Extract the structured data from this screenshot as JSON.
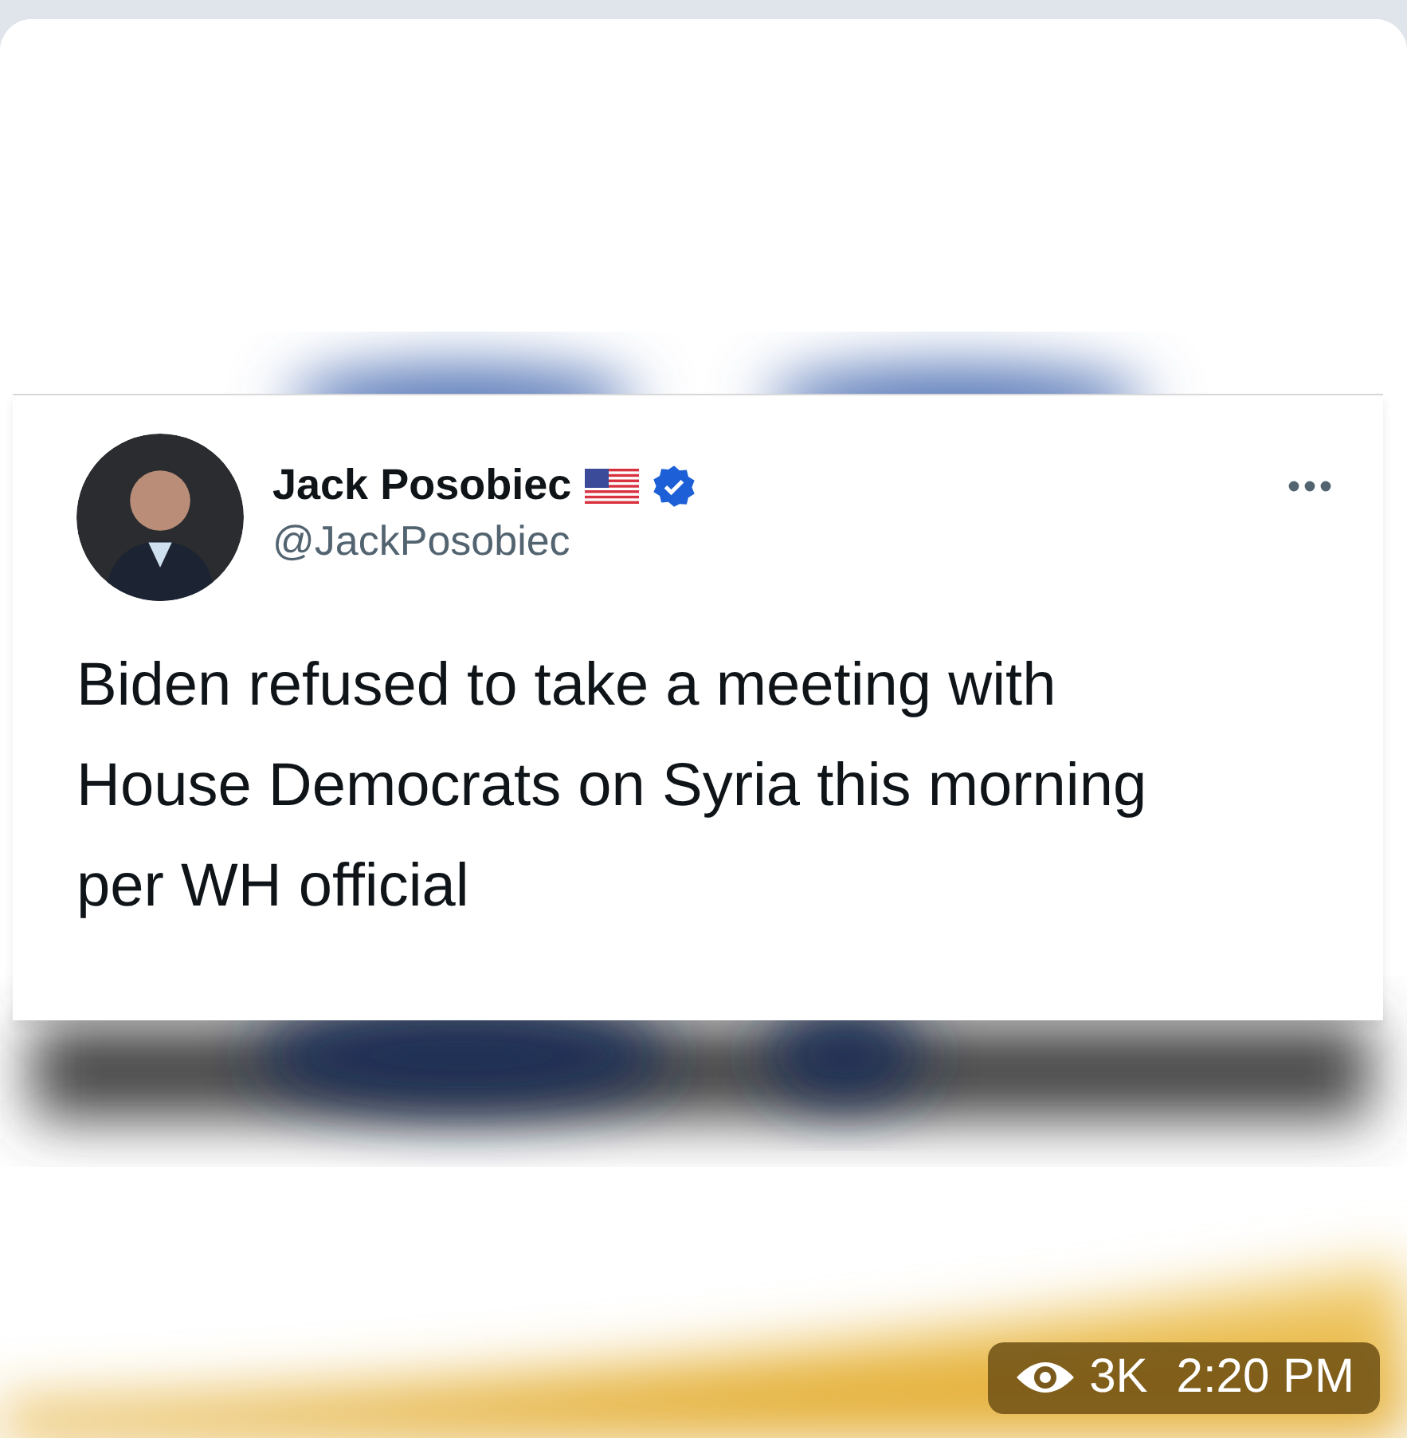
{
  "tweet": {
    "name": "Jack Posobiec",
    "handle": "@JackPosobiec",
    "verified": true,
    "text": "Biden refused to take a meeting with House Democrats on Syria this morning per WH official"
  },
  "message_meta": {
    "views": "3K",
    "time": "2:20 PM"
  }
}
